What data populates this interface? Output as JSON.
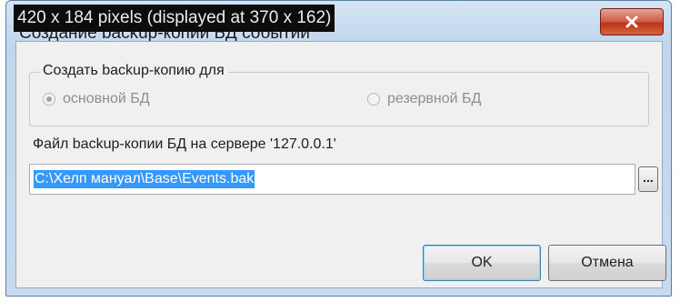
{
  "window": {
    "title": "Создание backup-копии БД событий",
    "overlay_caption": "420 x 184 pixels (displayed at 370 x 162)"
  },
  "backup_group": {
    "legend": "Создать backup-копию для",
    "options": [
      {
        "label": "основной БД",
        "selected": true,
        "enabled": false
      },
      {
        "label": "резервной БД",
        "selected": false,
        "enabled": false
      }
    ]
  },
  "file": {
    "label": "Файл backup-копии БД на сервере '127.0.0.1'",
    "path_value": "C:\\Хелп мануал\\Base\\Events.bak",
    "browse_label": "..."
  },
  "buttons": {
    "ok": "OK",
    "cancel": "Отмена"
  },
  "icons": {
    "close": "close-icon"
  },
  "colors": {
    "selection": "#3399ff",
    "close_button": "#c7472c"
  }
}
